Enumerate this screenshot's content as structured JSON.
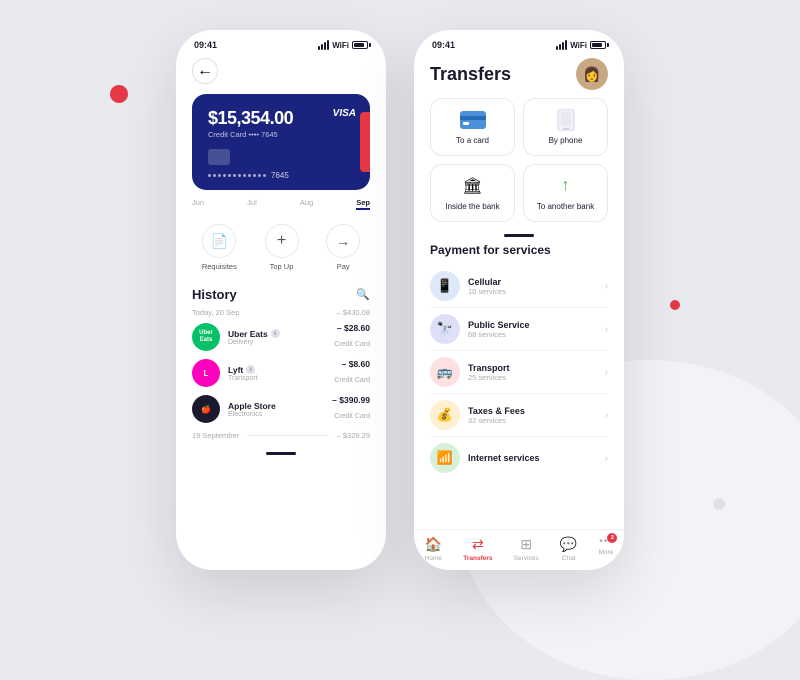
{
  "background": {
    "accent_red": "#e63946",
    "accent_gray": "#c5c8d4"
  },
  "phone_left": {
    "status_bar": {
      "time": "09:41"
    },
    "back_button_label": "←",
    "card": {
      "amount": "$15,354.00",
      "type_label": "Credit Card",
      "last4": "7645",
      "brand": "VISA"
    },
    "months": [
      "Jun",
      "Jul",
      "Aug",
      "Sep"
    ],
    "active_month": "Sep",
    "action_buttons": [
      {
        "id": "requisites",
        "label": "Requisites",
        "icon": "📄"
      },
      {
        "id": "top-up",
        "label": "Top Up",
        "icon": "+"
      },
      {
        "id": "pay",
        "label": "Pay",
        "icon": "→"
      }
    ],
    "history": {
      "title": "History",
      "date1": "Today, 20 Sep",
      "date1_total": "– $430.08",
      "items": [
        {
          "merchant": "Uber Eats",
          "sub": "Delivery",
          "amount": "– $28.60",
          "card": "Credit Card",
          "logo_bg": "#06c167",
          "logo_text": "Uber\nEats",
          "logo_color": "#fff"
        },
        {
          "merchant": "Lyft",
          "sub": "Transport",
          "amount": "– $8.60",
          "card": "Credit Card",
          "logo_bg": "#ff00bf",
          "logo_text": "L",
          "logo_color": "#fff"
        },
        {
          "merchant": "Apple Store",
          "sub": "Electronics",
          "amount": "– $390.99",
          "card": "Credit Card",
          "logo_bg": "#1a1a2e",
          "logo_text": "🍎",
          "logo_color": "#fff"
        }
      ],
      "date2": "19 September",
      "date2_total": "– $329.29"
    }
  },
  "phone_right": {
    "status_bar": {
      "time": "09:41"
    },
    "header": {
      "title": "Transfers"
    },
    "transfer_options": [
      {
        "id": "to-card",
        "label": "To a card",
        "icon": "💳"
      },
      {
        "id": "by-phone",
        "label": "By phone",
        "icon": "📱"
      },
      {
        "id": "inside-bank",
        "label": "Inside the bank",
        "icon": "🏛"
      },
      {
        "id": "another-bank",
        "label": "To another bank",
        "icon": "↑"
      }
    ],
    "payment_services": {
      "title": "Payment for services",
      "items": [
        {
          "id": "cellular",
          "name": "Cellular",
          "sub": "10 services",
          "icon": "📱",
          "icon_bg": "#4a90d9"
        },
        {
          "id": "public-service",
          "name": "Public Service",
          "sub": "68 services",
          "icon": "🔭",
          "icon_bg": "#3d5afe"
        },
        {
          "id": "transport",
          "name": "Transport",
          "sub": "25 services",
          "icon": "🚌",
          "icon_bg": "#e63946"
        },
        {
          "id": "taxes-fees",
          "name": "Taxes & Fees",
          "sub": "32 services",
          "icon": "💰",
          "icon_bg": "#f5a623"
        },
        {
          "id": "internet",
          "name": "Internet services",
          "sub": "",
          "icon": "📶",
          "icon_bg": "#4caf50"
        }
      ]
    },
    "bottom_nav": [
      {
        "id": "home",
        "label": "Home",
        "icon": "🏠",
        "active": false
      },
      {
        "id": "transfers",
        "label": "Transfers",
        "icon": "⇄",
        "active": true
      },
      {
        "id": "services",
        "label": "Services",
        "icon": "⊞",
        "active": false
      },
      {
        "id": "chat",
        "label": "Chat",
        "icon": "💬",
        "active": false
      },
      {
        "id": "more",
        "label": "More",
        "icon": "···",
        "active": false,
        "badge": "2"
      }
    ]
  }
}
